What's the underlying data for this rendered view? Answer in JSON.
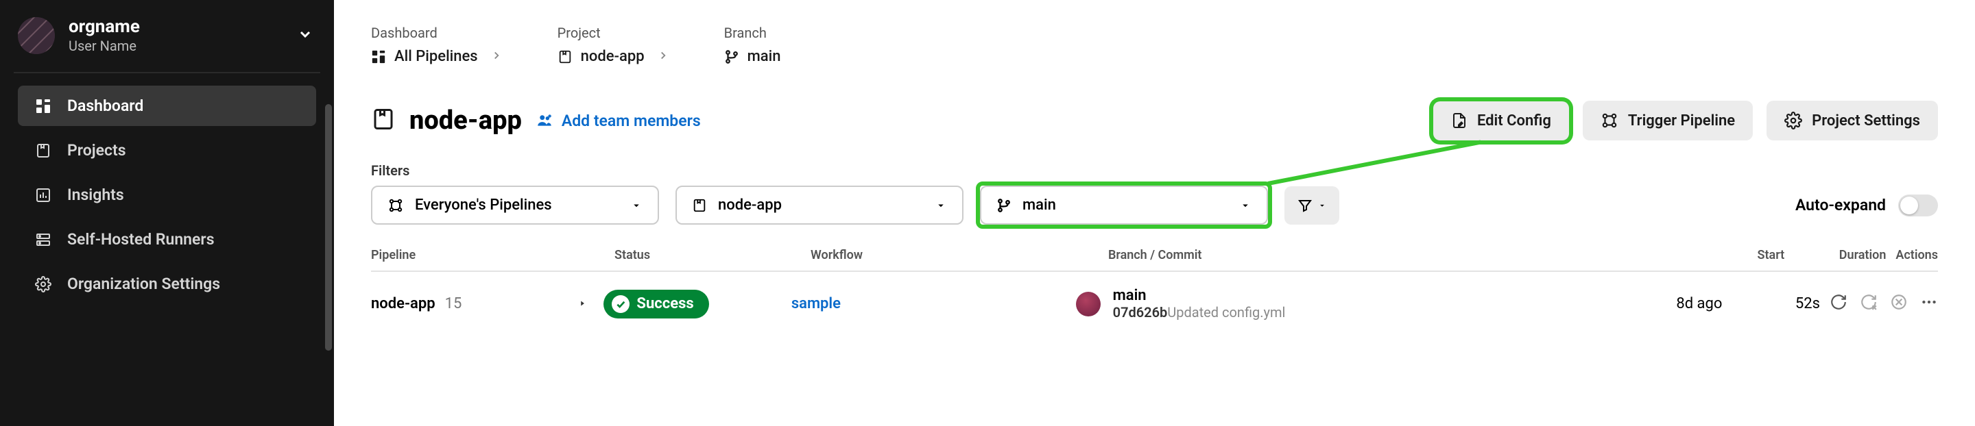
{
  "sidebar": {
    "org_name": "orgname",
    "user_name": "User Name",
    "items": [
      {
        "label": "Dashboard"
      },
      {
        "label": "Projects"
      },
      {
        "label": "Insights"
      },
      {
        "label": "Self-Hosted Runners"
      },
      {
        "label": "Organization Settings"
      }
    ]
  },
  "breadcrumbs": {
    "labels": {
      "dashboard": "Dashboard",
      "project": "Project",
      "branch": "Branch"
    },
    "dashboard_value": "All Pipelines",
    "project_value": "node-app",
    "branch_value": "main"
  },
  "project": {
    "title": "node-app",
    "add_team_label": "Add team members"
  },
  "actions": {
    "edit_config": "Edit Config",
    "trigger_pipeline": "Trigger Pipeline",
    "project_settings": "Project Settings"
  },
  "filters": {
    "label": "Filters",
    "everyone": "Everyone's Pipelines",
    "project": "node-app",
    "branch": "main",
    "auto_expand": "Auto-expand"
  },
  "table": {
    "headers": {
      "pipeline": "Pipeline",
      "status": "Status",
      "workflow": "Workflow",
      "branch": "Branch / Commit",
      "start": "Start",
      "duration": "Duration",
      "actions": "Actions"
    },
    "rows": [
      {
        "pipeline_name": "node-app",
        "pipeline_number": "15",
        "status": "Success",
        "workflow": "sample",
        "branch": "main",
        "commit_hash": "07d626b",
        "commit_msg": "Updated config.yml",
        "start": "8d ago",
        "duration": "52s"
      }
    ]
  }
}
